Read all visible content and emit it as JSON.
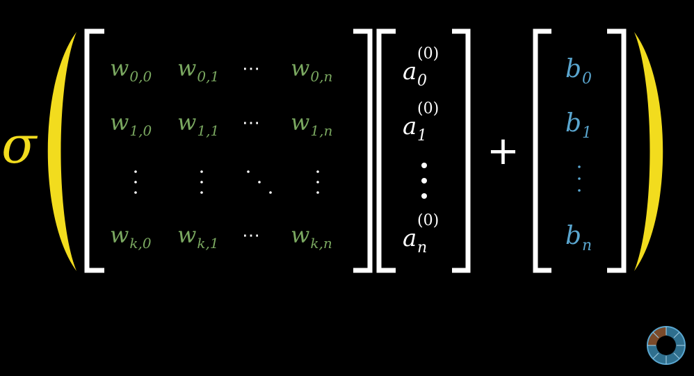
{
  "colors": {
    "background": "#000000",
    "sigma": "#f2dc1e",
    "weights": "#7aa860",
    "activations": "#ffffff",
    "biases": "#5aa6cf",
    "brackets": "#ffffff",
    "parens": "#f2dc1e"
  },
  "formula": {
    "sigma": "σ",
    "plus": "+",
    "ellipsis": "⋯",
    "weights": {
      "symbol": "w",
      "rows": [
        [
          "0,0",
          "0,1",
          "⋯",
          "0,n"
        ],
        [
          "1,0",
          "1,1",
          "⋯",
          "1,n"
        ],
        [
          "⋮",
          "⋮",
          "⋱",
          "⋮"
        ],
        [
          "k,0",
          "k,1",
          "⋯",
          "k,n"
        ]
      ]
    },
    "activations": {
      "symbol": "a",
      "superscript": "(0)",
      "subscripts": [
        "0",
        "1",
        "⋮",
        "n"
      ]
    },
    "biases": {
      "symbol": "b",
      "subscripts": [
        "0",
        "1",
        "⋮",
        "n"
      ]
    }
  },
  "logo_icon": "3b1b-pi-eye-icon"
}
